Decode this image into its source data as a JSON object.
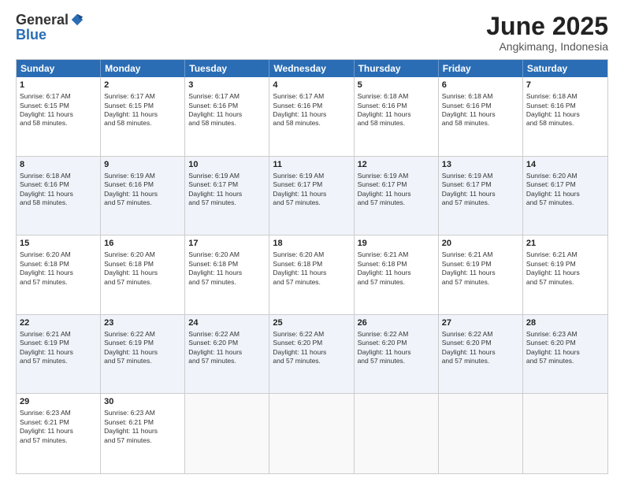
{
  "logo": {
    "general": "General",
    "blue": "Blue"
  },
  "title": "June 2025",
  "subtitle": "Angkimang, Indonesia",
  "header_days": [
    "Sunday",
    "Monday",
    "Tuesday",
    "Wednesday",
    "Thursday",
    "Friday",
    "Saturday"
  ],
  "weeks": [
    [
      {
        "day": "1",
        "lines": [
          "Sunrise: 6:17 AM",
          "Sunset: 6:15 PM",
          "Daylight: 11 hours",
          "and 58 minutes."
        ]
      },
      {
        "day": "2",
        "lines": [
          "Sunrise: 6:17 AM",
          "Sunset: 6:15 PM",
          "Daylight: 11 hours",
          "and 58 minutes."
        ]
      },
      {
        "day": "3",
        "lines": [
          "Sunrise: 6:17 AM",
          "Sunset: 6:16 PM",
          "Daylight: 11 hours",
          "and 58 minutes."
        ]
      },
      {
        "day": "4",
        "lines": [
          "Sunrise: 6:17 AM",
          "Sunset: 6:16 PM",
          "Daylight: 11 hours",
          "and 58 minutes."
        ]
      },
      {
        "day": "5",
        "lines": [
          "Sunrise: 6:18 AM",
          "Sunset: 6:16 PM",
          "Daylight: 11 hours",
          "and 58 minutes."
        ]
      },
      {
        "day": "6",
        "lines": [
          "Sunrise: 6:18 AM",
          "Sunset: 6:16 PM",
          "Daylight: 11 hours",
          "and 58 minutes."
        ]
      },
      {
        "day": "7",
        "lines": [
          "Sunrise: 6:18 AM",
          "Sunset: 6:16 PM",
          "Daylight: 11 hours",
          "and 58 minutes."
        ]
      }
    ],
    [
      {
        "day": "8",
        "lines": [
          "Sunrise: 6:18 AM",
          "Sunset: 6:16 PM",
          "Daylight: 11 hours",
          "and 58 minutes."
        ]
      },
      {
        "day": "9",
        "lines": [
          "Sunrise: 6:19 AM",
          "Sunset: 6:16 PM",
          "Daylight: 11 hours",
          "and 57 minutes."
        ]
      },
      {
        "day": "10",
        "lines": [
          "Sunrise: 6:19 AM",
          "Sunset: 6:17 PM",
          "Daylight: 11 hours",
          "and 57 minutes."
        ]
      },
      {
        "day": "11",
        "lines": [
          "Sunrise: 6:19 AM",
          "Sunset: 6:17 PM",
          "Daylight: 11 hours",
          "and 57 minutes."
        ]
      },
      {
        "day": "12",
        "lines": [
          "Sunrise: 6:19 AM",
          "Sunset: 6:17 PM",
          "Daylight: 11 hours",
          "and 57 minutes."
        ]
      },
      {
        "day": "13",
        "lines": [
          "Sunrise: 6:19 AM",
          "Sunset: 6:17 PM",
          "Daylight: 11 hours",
          "and 57 minutes."
        ]
      },
      {
        "day": "14",
        "lines": [
          "Sunrise: 6:20 AM",
          "Sunset: 6:17 PM",
          "Daylight: 11 hours",
          "and 57 minutes."
        ]
      }
    ],
    [
      {
        "day": "15",
        "lines": [
          "Sunrise: 6:20 AM",
          "Sunset: 6:18 PM",
          "Daylight: 11 hours",
          "and 57 minutes."
        ]
      },
      {
        "day": "16",
        "lines": [
          "Sunrise: 6:20 AM",
          "Sunset: 6:18 PM",
          "Daylight: 11 hours",
          "and 57 minutes."
        ]
      },
      {
        "day": "17",
        "lines": [
          "Sunrise: 6:20 AM",
          "Sunset: 6:18 PM",
          "Daylight: 11 hours",
          "and 57 minutes."
        ]
      },
      {
        "day": "18",
        "lines": [
          "Sunrise: 6:20 AM",
          "Sunset: 6:18 PM",
          "Daylight: 11 hours",
          "and 57 minutes."
        ]
      },
      {
        "day": "19",
        "lines": [
          "Sunrise: 6:21 AM",
          "Sunset: 6:18 PM",
          "Daylight: 11 hours",
          "and 57 minutes."
        ]
      },
      {
        "day": "20",
        "lines": [
          "Sunrise: 6:21 AM",
          "Sunset: 6:19 PM",
          "Daylight: 11 hours",
          "and 57 minutes."
        ]
      },
      {
        "day": "21",
        "lines": [
          "Sunrise: 6:21 AM",
          "Sunset: 6:19 PM",
          "Daylight: 11 hours",
          "and 57 minutes."
        ]
      }
    ],
    [
      {
        "day": "22",
        "lines": [
          "Sunrise: 6:21 AM",
          "Sunset: 6:19 PM",
          "Daylight: 11 hours",
          "and 57 minutes."
        ]
      },
      {
        "day": "23",
        "lines": [
          "Sunrise: 6:22 AM",
          "Sunset: 6:19 PM",
          "Daylight: 11 hours",
          "and 57 minutes."
        ]
      },
      {
        "day": "24",
        "lines": [
          "Sunrise: 6:22 AM",
          "Sunset: 6:20 PM",
          "Daylight: 11 hours",
          "and 57 minutes."
        ]
      },
      {
        "day": "25",
        "lines": [
          "Sunrise: 6:22 AM",
          "Sunset: 6:20 PM",
          "Daylight: 11 hours",
          "and 57 minutes."
        ]
      },
      {
        "day": "26",
        "lines": [
          "Sunrise: 6:22 AM",
          "Sunset: 6:20 PM",
          "Daylight: 11 hours",
          "and 57 minutes."
        ]
      },
      {
        "day": "27",
        "lines": [
          "Sunrise: 6:22 AM",
          "Sunset: 6:20 PM",
          "Daylight: 11 hours",
          "and 57 minutes."
        ]
      },
      {
        "day": "28",
        "lines": [
          "Sunrise: 6:23 AM",
          "Sunset: 6:20 PM",
          "Daylight: 11 hours",
          "and 57 minutes."
        ]
      }
    ],
    [
      {
        "day": "29",
        "lines": [
          "Sunrise: 6:23 AM",
          "Sunset: 6:21 PM",
          "Daylight: 11 hours",
          "and 57 minutes."
        ]
      },
      {
        "day": "30",
        "lines": [
          "Sunrise: 6:23 AM",
          "Sunset: 6:21 PM",
          "Daylight: 11 hours",
          "and 57 minutes."
        ]
      },
      {
        "day": "",
        "lines": []
      },
      {
        "day": "",
        "lines": []
      },
      {
        "day": "",
        "lines": []
      },
      {
        "day": "",
        "lines": []
      },
      {
        "day": "",
        "lines": []
      }
    ]
  ],
  "alt_rows": [
    1,
    3
  ]
}
